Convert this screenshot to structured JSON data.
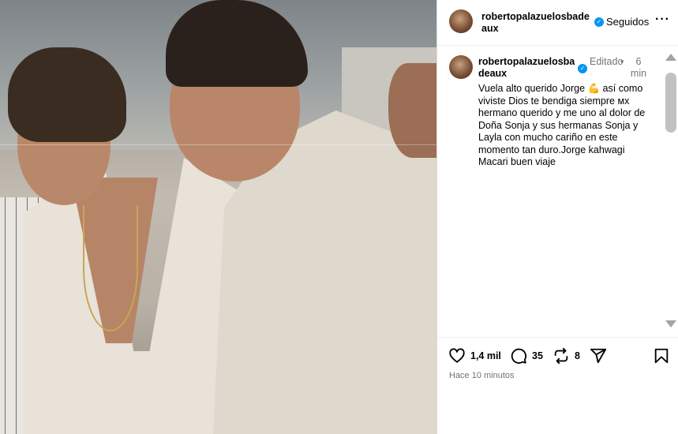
{
  "post": {
    "image_alt": "Photo of two men smiling in light shirts"
  },
  "header": {
    "username": "robertopalazuelosbadeaux",
    "verified_icon": "verified-badge-icon",
    "follow_label": "Seguidos",
    "more_label": "···"
  },
  "comment": {
    "username": "robertopalazuelosbadeaux",
    "edited_label": "Editado",
    "dot": "•",
    "time": "6 min",
    "caption": "Vuela alto querido Jorge 💪 así como viviste Dios te bendiga siempre ᴍx hermano querido y me uno al dolor de Doña Sonja  y sus hermanas Sonja y Layla  con mucho cariño en este momento tan duro.Jorge kahwagi Macari  buen viaje"
  },
  "actions": {
    "likes": "1,4 mil",
    "comments": "35",
    "reposts": "8",
    "timestamp": "Hace 10 minutos"
  },
  "colors": {
    "verified": "#0095f6",
    "muted_text": "#737373",
    "divider": "#efefef"
  }
}
